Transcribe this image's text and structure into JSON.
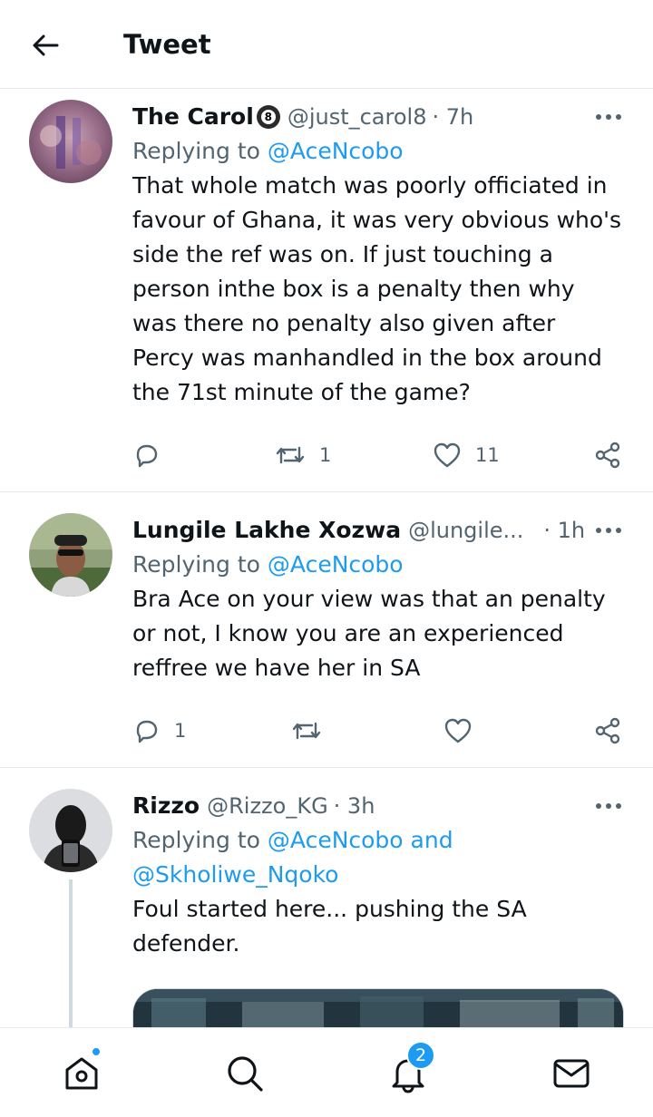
{
  "header": {
    "title": "Tweet"
  },
  "tweets": [
    {
      "name": "The Carol",
      "badge_icon": "eight-ball-icon",
      "badge_text": "8",
      "handle": "@just_carol8",
      "time": "· 7h",
      "reply_prefix": "Replying to",
      "mention1": "@AceNcobo",
      "text": "That whole match was poorly officiated in favour of Ghana, it was very obvious who's side the ref was on. If just touching a person inthe box is a penalty then why was there no penalty also given after Percy was manhandled in the box around the 71st minute of the game?",
      "retweets": "1",
      "likes": "11"
    },
    {
      "name": "Lungile Lakhe Xozwa",
      "handle": "@lungile...",
      "time": "· 1h",
      "reply_prefix": "Replying to",
      "mention1": "@AceNcobo",
      "text": "Bra Ace on your view was that an penalty or not, I know you are an experienced reffree we have her in SA",
      "replies": "1"
    },
    {
      "name": "Rizzo",
      "handle": "@Rizzo_KG",
      "time": "· 3h",
      "reply_prefix": "Replying to",
      "mention1": "@AceNcobo and",
      "mention2": "@Skholiwe_Nqoko",
      "text": "Foul started here... pushing the SA defender."
    }
  ],
  "nav": {
    "notifications_badge": "2"
  },
  "colors": {
    "accent": "#1d9bf0",
    "secondary_text": "#536471",
    "divider": "#e6e9ec"
  }
}
